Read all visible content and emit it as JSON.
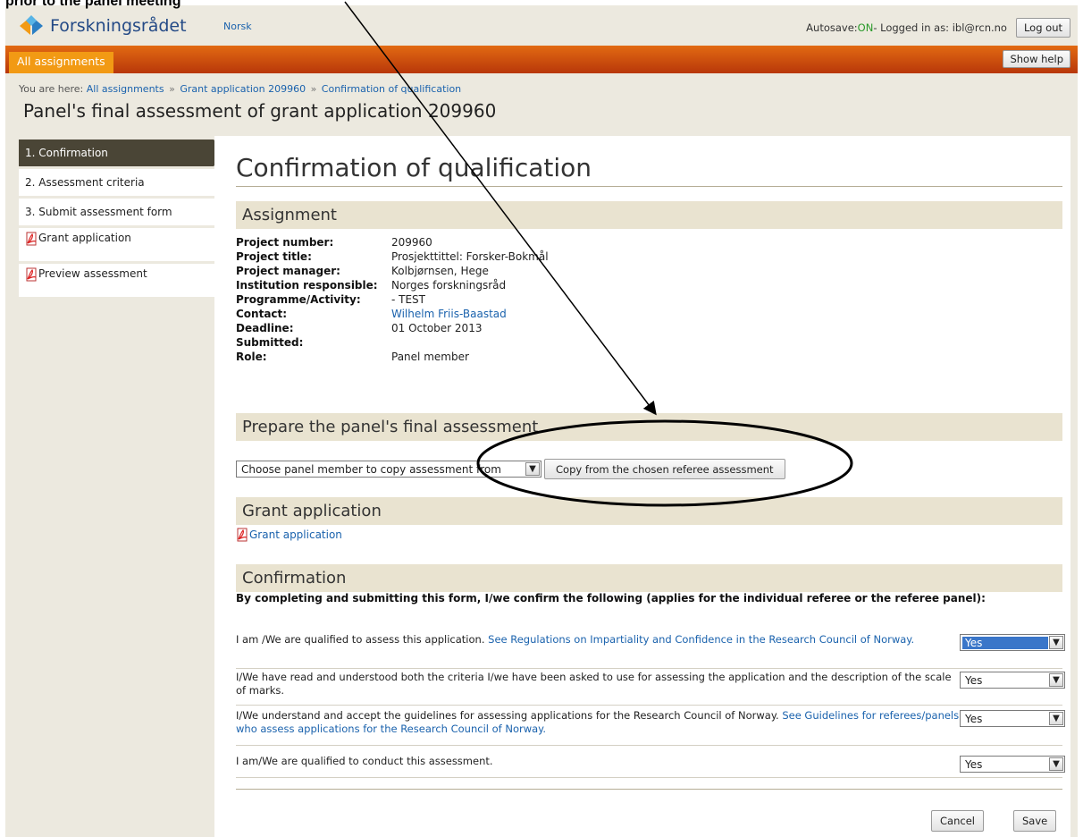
{
  "annotation": {
    "label": "prior to the panel meeting"
  },
  "header": {
    "logo_text": "Forskningsrådet",
    "language_link": "Norsk",
    "autosave_label": "Autosave: ",
    "autosave_state": "ON",
    "logged_in_text": " - Logged in as: ibl@rcn.no",
    "logout_label": "Log out"
  },
  "nav": {
    "all_assignments": "All assignments",
    "show_help": "Show help"
  },
  "breadcrumb": {
    "prefix": "You are here: ",
    "items": [
      "All assignments",
      "Grant application 209960",
      "Confirmation of qualification"
    ],
    "separator": "»"
  },
  "page_title": "Panel's final assessment of grant application 209960",
  "sidebar": {
    "items": [
      {
        "label": "1. Confirmation"
      },
      {
        "label": "2. Assessment criteria"
      },
      {
        "label": "3. Submit assessment form"
      },
      {
        "label": "Grant application"
      },
      {
        "label": "Preview assessment"
      }
    ]
  },
  "content": {
    "title": "Confirmation of qualification",
    "assignment": {
      "heading": "Assignment",
      "rows": [
        {
          "label": "Project number:",
          "value": "209960"
        },
        {
          "label": "Project title:",
          "value": "Prosjekttittel: Forsker-Bokmål"
        },
        {
          "label": "Project manager:",
          "value": "Kolbjørnsen, Hege"
        },
        {
          "label": "Institution responsible:",
          "value": "Norges forskningsråd"
        },
        {
          "label": "Programme/Activity:",
          "value": "- TEST"
        },
        {
          "label": "Contact:",
          "value": "Wilhelm Friis-Baastad"
        },
        {
          "label": "Deadline:",
          "value": "01 October 2013"
        },
        {
          "label": "Submitted:",
          "value": ""
        },
        {
          "label": "Role:",
          "value": "Panel member"
        }
      ]
    },
    "prepare": {
      "heading": "Prepare the panel's final assessment",
      "select_value": "Choose panel member to copy assessment from",
      "copy_button": "Copy from the chosen referee assessment"
    },
    "grant": {
      "heading": "Grant application",
      "link": "Grant application"
    },
    "confirmation": {
      "heading": "Confirmation",
      "intro": "By completing and submitting this form, I/we confirm the following (applies for the individual referee or the referee panel):",
      "rows": [
        {
          "text": "I am /We are qualified to assess this application. ",
          "link": "See Regulations on Impartiality and Confidence in the Research Council of Norway.",
          "value": "Yes"
        },
        {
          "text": "I/We have read and understood both the criteria I/we have been asked to use for assessing the application and the description of the scale of marks.",
          "link": "",
          "value": "Yes"
        },
        {
          "text": "I/We understand and accept the guidelines for assessing applications for the Research Council of Norway. ",
          "link": "See Guidelines for referees/panels who assess applications for the Research Council of Norway.",
          "value": "Yes"
        },
        {
          "text": "I am/We are qualified to conduct this assessment.",
          "link": "",
          "value": "Yes"
        }
      ]
    },
    "cancel_button": "Cancel",
    "save_button": "Save"
  },
  "colors": {
    "nav_orange": "#e26a12",
    "tab_orange": "#f29a14",
    "link_blue": "#1a62ad",
    "autosave_green": "#2a9a2a",
    "section_bg": "#e9e3d0",
    "active_sidebar": "#4a4536"
  }
}
